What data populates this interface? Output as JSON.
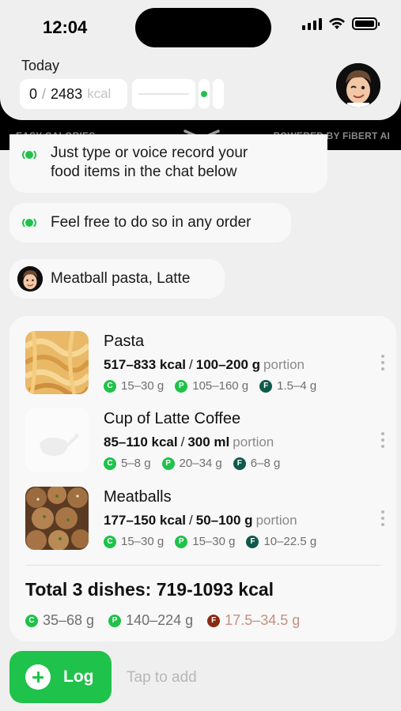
{
  "status_bar": {
    "time": "12:04"
  },
  "header": {
    "today_label": "Today",
    "kcal_consumed": "0",
    "kcal_separator": "/",
    "kcal_goal": "2483",
    "kcal_unit": "kcal",
    "progress_fraction": 0
  },
  "brand": {
    "left": "EASY CALORIES",
    "right": "POWERED BY FiBERT AI"
  },
  "chat": {
    "messages": [
      {
        "from": "ai",
        "lines": [
          "Just type or voice record your",
          "food items in the chat below"
        ]
      },
      {
        "from": "ai",
        "text": "Feel free to do so in any order"
      },
      {
        "from": "user",
        "text": "Meatball pasta, Latte"
      }
    ]
  },
  "dishes": [
    {
      "name": "Pasta",
      "kcal": "517–833 kcal",
      "amount": "100–200 g",
      "portion_label": "portion",
      "carbs": "15–30 g",
      "protein": "105–160 g",
      "fat": "1.5–4 g"
    },
    {
      "name": "Cup of Latte Coffee",
      "kcal": "85–110 kcal",
      "amount": "300 ml",
      "portion_label": "portion",
      "carbs": "5–8 g",
      "protein": "20–34 g",
      "fat": "6–8 g"
    },
    {
      "name": "Meatballs",
      "kcal": "177–150 kcal",
      "amount": "50–100 g",
      "portion_label": "portion",
      "carbs": "15–30 g",
      "protein": "15–30 g",
      "fat": "10–22.5 g"
    }
  ],
  "badges": {
    "carbs": "C",
    "protein": "P",
    "fat": "F"
  },
  "totals": {
    "title": "Total 3 dishes: 719-1093 kcal",
    "carbs": "35–68 g",
    "protein": "140–224 g",
    "fat": "17.5–34.5 g"
  },
  "bottom": {
    "log_label": "Log",
    "input_placeholder": "Tap to add"
  },
  "colors": {
    "accent_green": "#1fc24a",
    "fat_badge_dark": "#0f5a4a",
    "fat_warning": "#8a2a12",
    "fat_warning_text": "#c49080"
  },
  "icons": [
    "signal-icon",
    "wifi-icon",
    "battery-icon",
    "chevron-down-icon",
    "ai-dot-icon",
    "kebab-menu-icon",
    "plus-icon"
  ]
}
